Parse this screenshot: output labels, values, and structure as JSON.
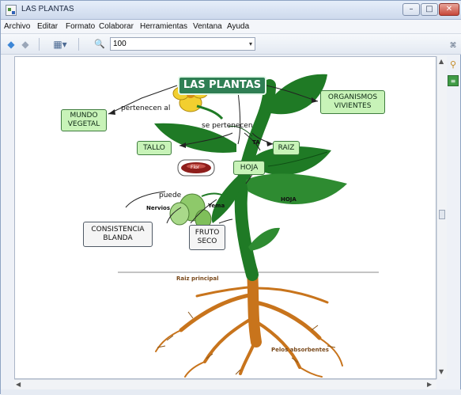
{
  "window": {
    "title": "LAS PLANTAS",
    "minimize": "–",
    "maximize": "□",
    "close": "✕"
  },
  "menu": [
    "Archivo",
    "Editar",
    "Formato",
    "Colaborar",
    "Herramientas",
    "Ventana",
    "Ayuda"
  ],
  "toolbar": {
    "back_icon": "◆",
    "forward_icon": "◆",
    "view_icon": "▦▾",
    "zoom_icon": "🔍",
    "zoom_value": "100",
    "dropdown_arrow": "▾"
  },
  "map": {
    "title": "LAS PLANTAS",
    "nodes": {
      "mundo_vegetal": "MUNDO VEGETAL",
      "organismos_vivientes": "ORGANISMOS VIVIENTES",
      "tallo": "TALLO",
      "raiz": "RAIZ",
      "hoja": "HOJA",
      "consistencia_blanda": "CONSISTENCIA BLANDA",
      "fruto_seco": "FRUTO SECO"
    },
    "labels": {
      "pertenecen_al": "pertenecen al",
      "se_pertenecen": "se pertenecen",
      "ta": "TA",
      "hoja_diagram": "HOJA",
      "flor": "Flor",
      "puede": "puede",
      "nervios": "Nervios",
      "yema": "Yema",
      "raiz_principal": "Raiz principal",
      "pelos_absorbentes": "Pelos absorbentes"
    }
  },
  "colors": {
    "leaf": "#1f7a25",
    "leaf_light": "#8ec96a",
    "root": "#c8741c",
    "flower": "#f2cf2f",
    "title_node": "#2f7f54"
  }
}
